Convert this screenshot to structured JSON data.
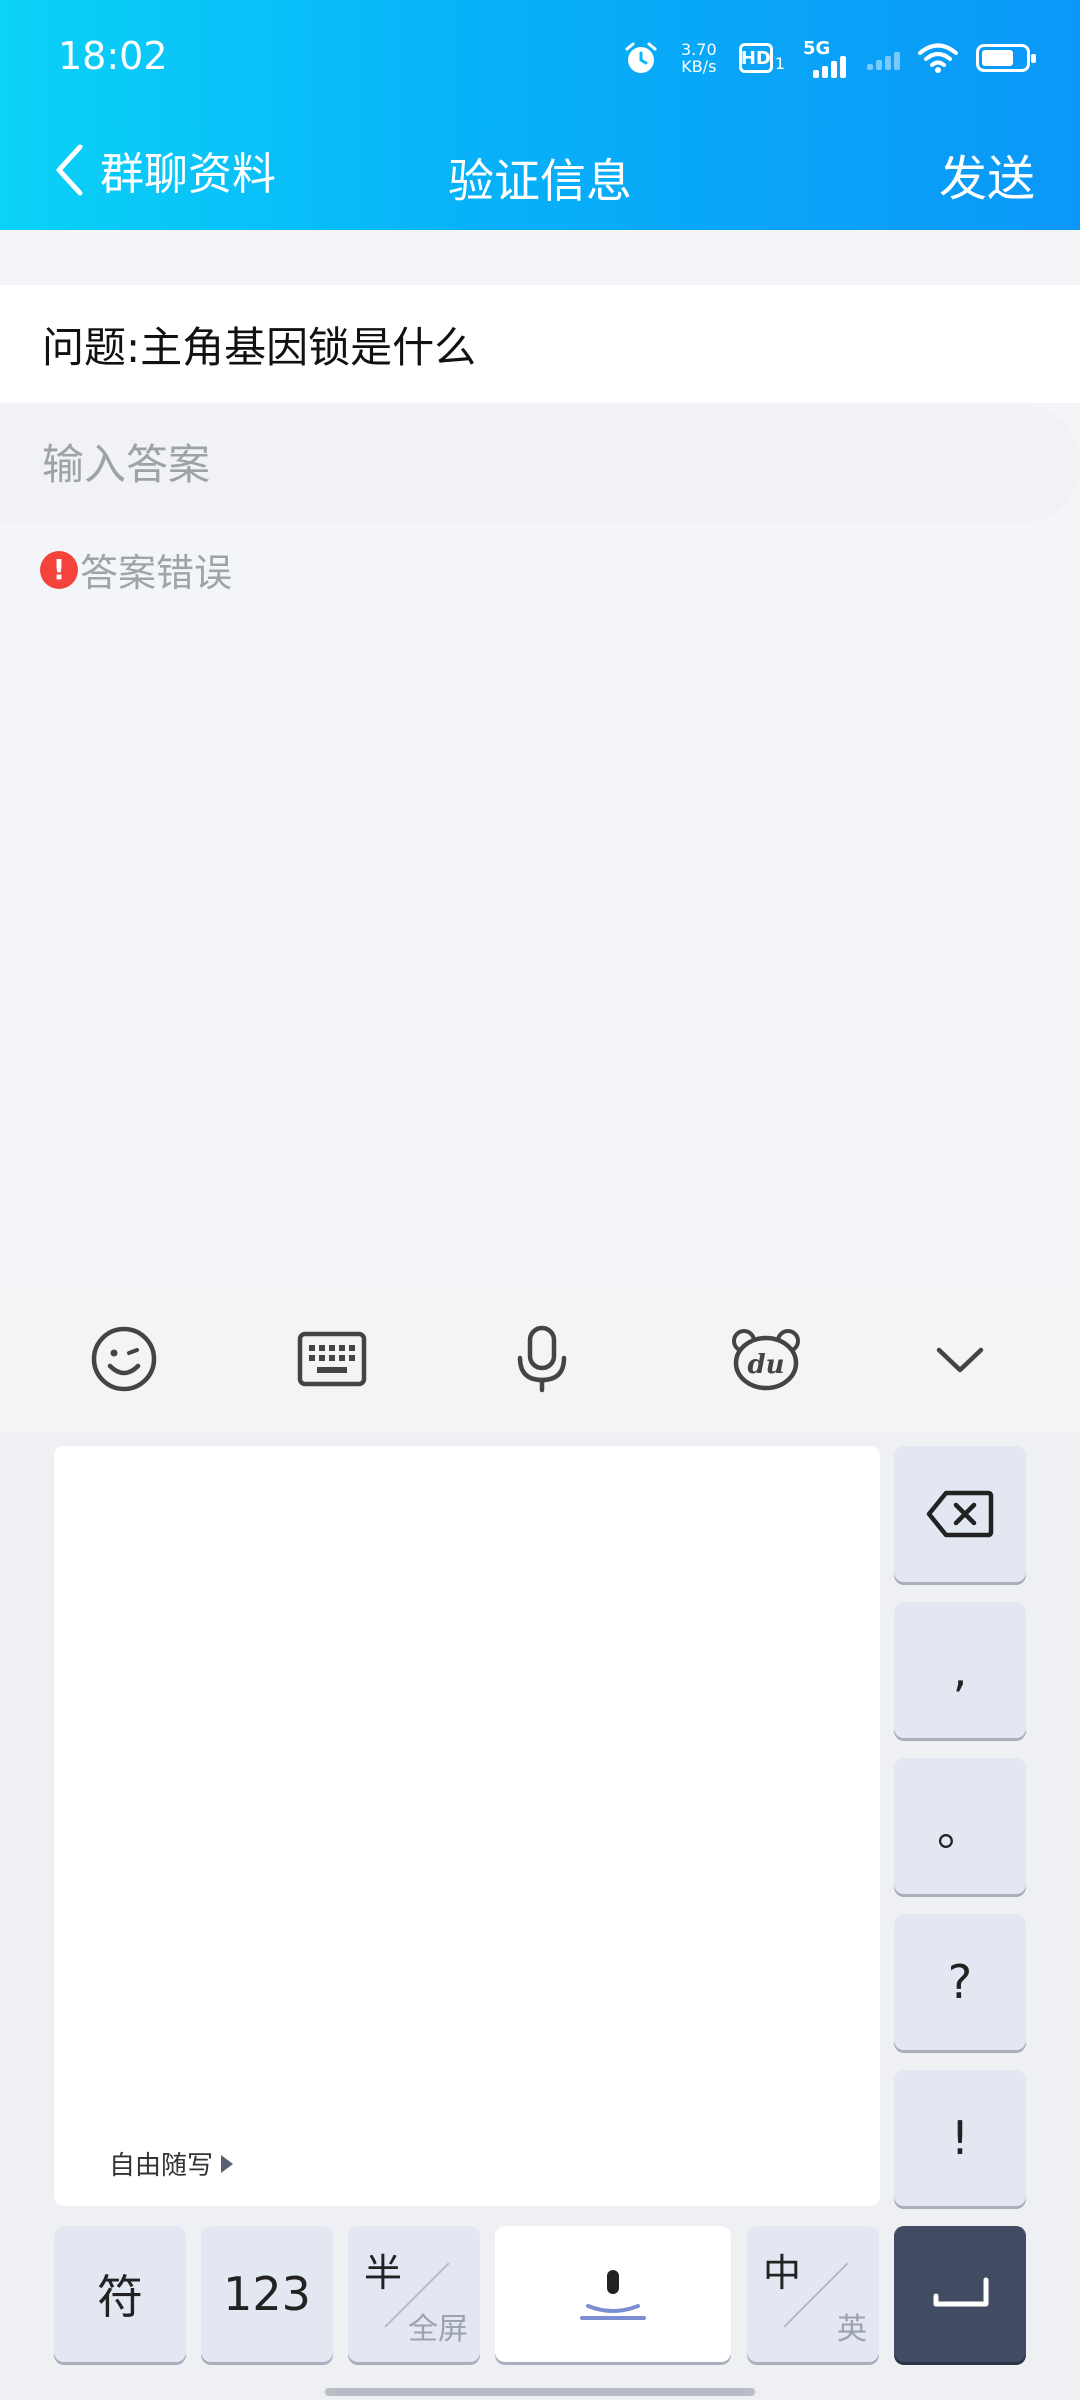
{
  "status_bar": {
    "time": "18:02",
    "net_speed": "3.70",
    "net_speed_unit": "KB/s",
    "hd_label": "HD",
    "hd_sub": "1",
    "network_label": "5G"
  },
  "nav": {
    "back_label": "群聊资料",
    "title": "验证信息",
    "send_label": "发送"
  },
  "form": {
    "question": "问题:主角基因锁是什么",
    "answer_placeholder": "输入答案",
    "answer_value": "",
    "error_icon": "!",
    "error_text": "答案错误"
  },
  "keyboard": {
    "toolbar_icons": [
      "emoji-icon",
      "keyboard-icon",
      "microphone-icon",
      "du-bear-icon",
      "collapse-chevron-icon"
    ],
    "handwriting_label": "自由随写",
    "side_keys": [
      ",",
      "。",
      "?",
      "!"
    ],
    "symbol_key": "符",
    "number_key": "123",
    "half_full": {
      "main": "半",
      "sub": "全屏"
    },
    "lang": {
      "main": "中",
      "sub": "英"
    }
  },
  "colors": {
    "header_gradient_start": "#0bd2f7",
    "header_gradient_end": "#0b97f7",
    "error_red": "#f4433a",
    "enter_key": "#414b62"
  }
}
